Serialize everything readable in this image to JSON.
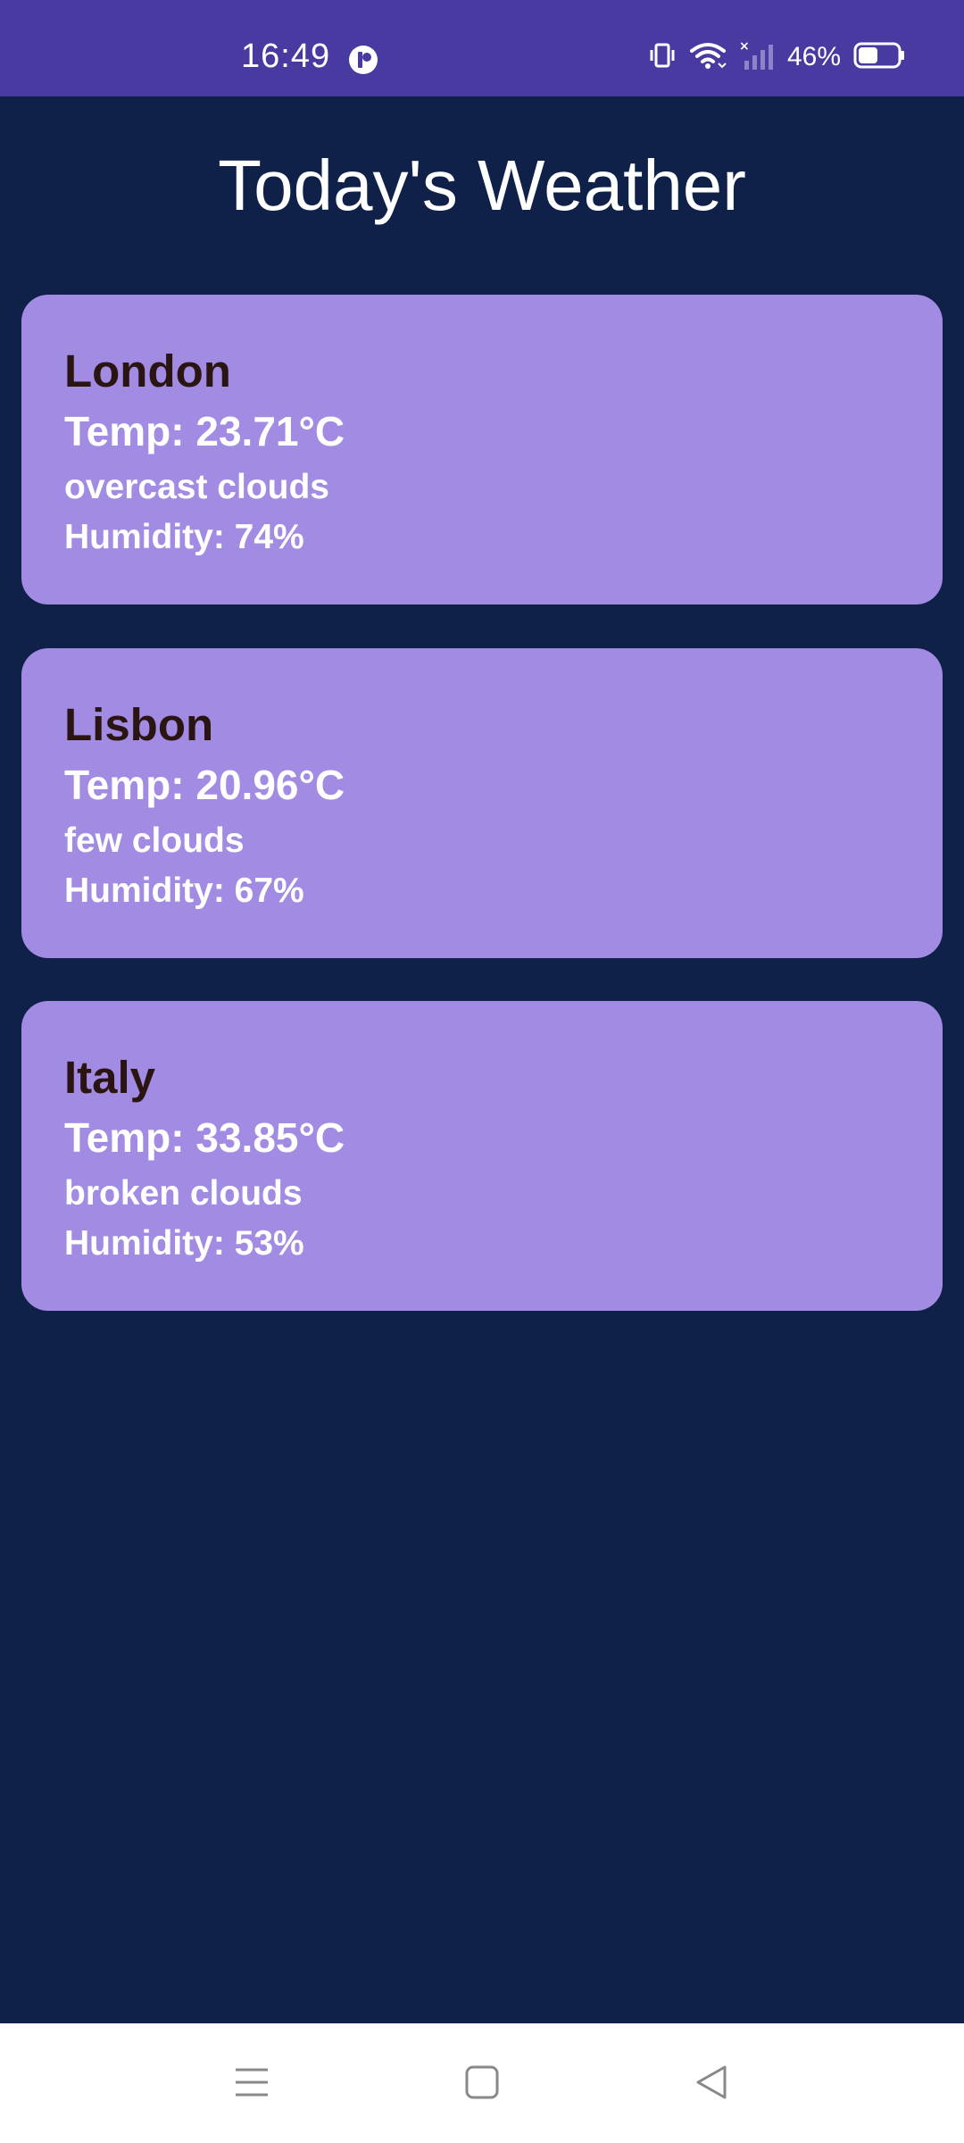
{
  "status_bar": {
    "time": "16:49",
    "battery_percent": "46%",
    "colors": {
      "background": "#473aa1",
      "text": "#ffffff"
    },
    "icons": [
      "app-notification-icon",
      "vibrate-icon",
      "wifi-icon",
      "no-signal-icon",
      "battery-icon"
    ]
  },
  "page": {
    "title": "Today's Weather",
    "background_color": "#0f2149"
  },
  "cards": [
    {
      "city": "London",
      "temp": "Temp: 23.71°C",
      "description": "overcast clouds",
      "humidity": "Humidity: 74%"
    },
    {
      "city": "Lisbon",
      "temp": "Temp: 20.96°C",
      "description": "few clouds",
      "humidity": "Humidity: 67%"
    },
    {
      "city": "Italy",
      "temp": "Temp: 33.85°C",
      "description": "broken clouds",
      "humidity": "Humidity: 53%"
    }
  ],
  "card_colors": {
    "background": "#a28be2",
    "city_text": "#2b1512",
    "detail_text": "#ffffff"
  },
  "nav_bar": {
    "icons": [
      "menu-icon",
      "home-icon",
      "back-icon"
    ]
  }
}
